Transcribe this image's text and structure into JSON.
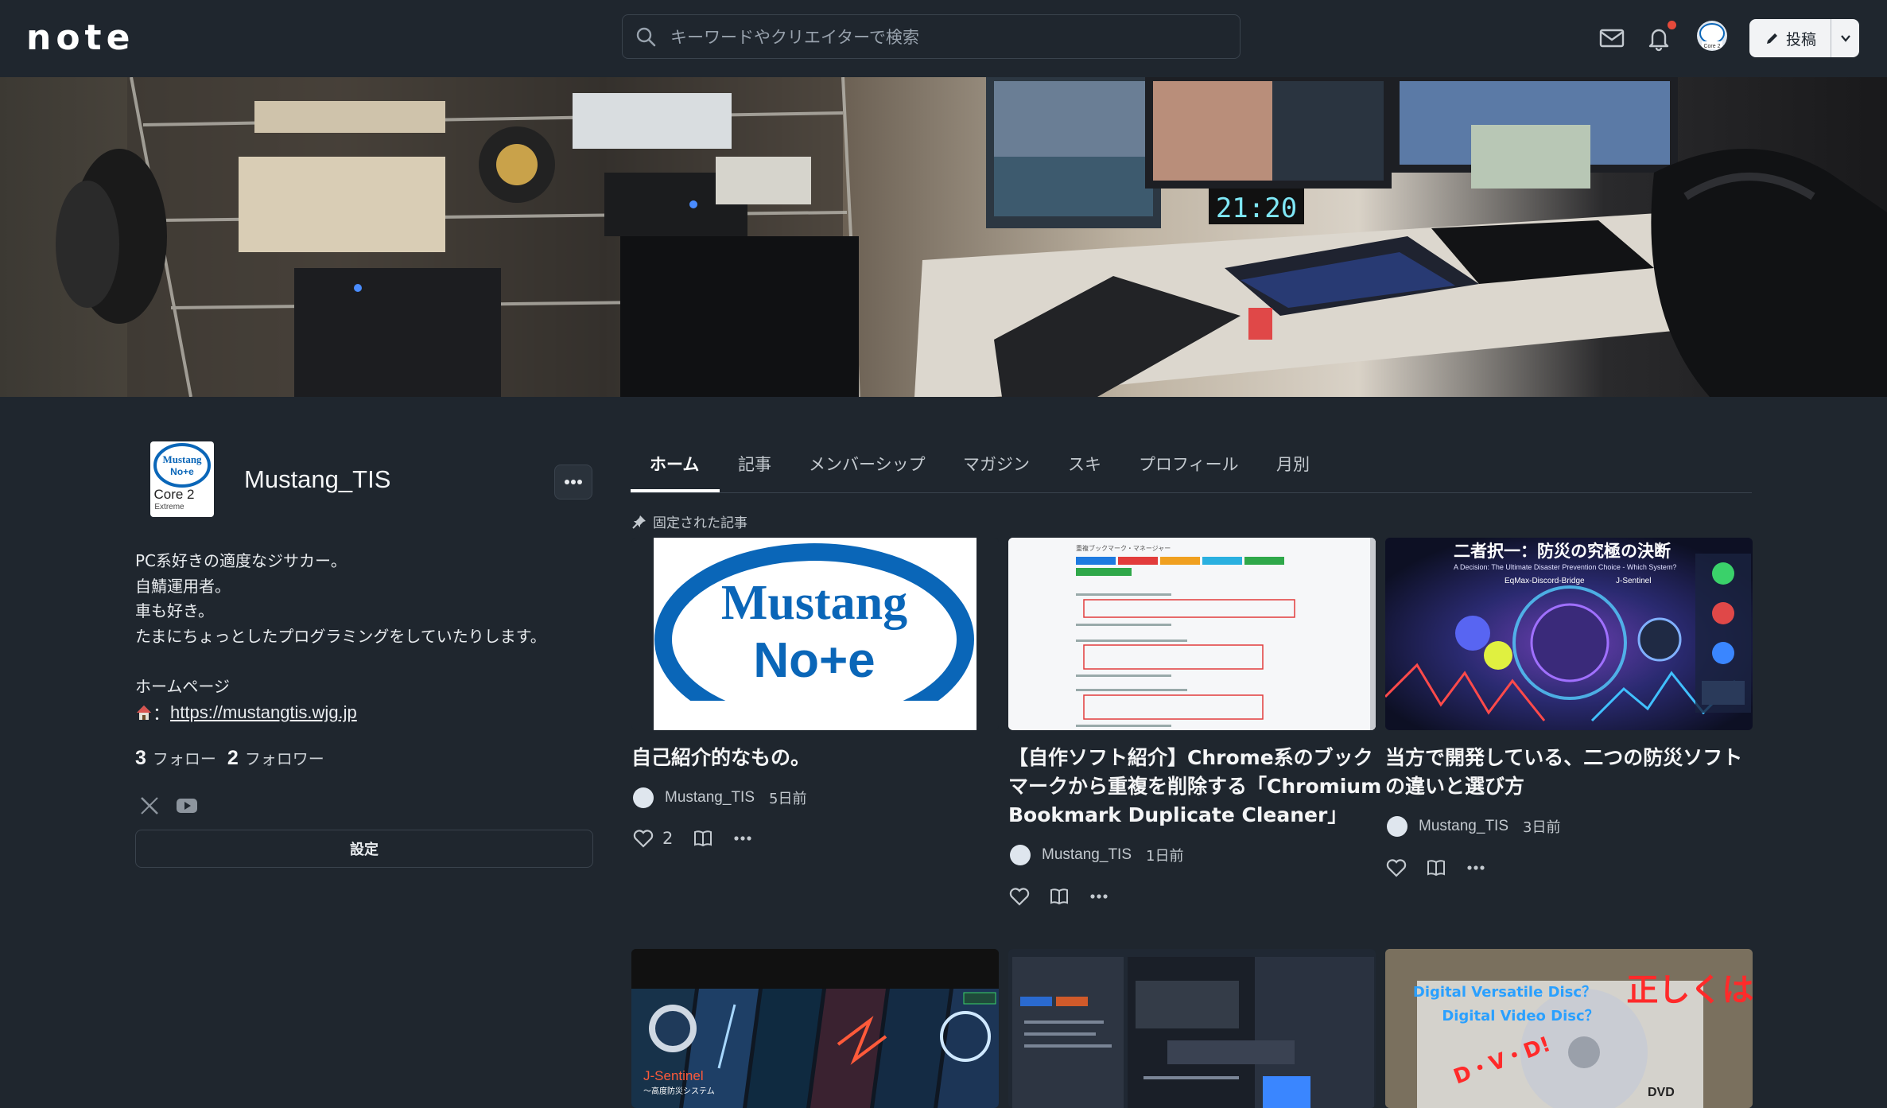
{
  "header": {
    "logo": "note",
    "search_placeholder": "キーワードやクリエイターで検索",
    "post_label": "投稿"
  },
  "profile": {
    "name": "Mustang_TIS",
    "bio": "PC系好きの適度なジサカー。\n自鯖運用者。\n車も好き。\nたまにちょっとしたプログラミングをしていたりします。\n\nホームページ",
    "homepage_prefix": "：",
    "homepage_url": "https://mustangtis.wjg.jp",
    "follow_count": "3",
    "follow_label": "フォロー",
    "follower_count": "2",
    "follower_label": "フォロワー",
    "settings_label": "設定",
    "avatar_text_1": "Mustang",
    "avatar_text_2": "No+e",
    "avatar_text_3": "Core 2",
    "avatar_text_4": "Extreme"
  },
  "tabs": [
    {
      "label": "ホーム",
      "active": true
    },
    {
      "label": "記事"
    },
    {
      "label": "メンバーシップ"
    },
    {
      "label": "マガジン"
    },
    {
      "label": "スキ"
    },
    {
      "label": "プロフィール"
    },
    {
      "label": "月別"
    }
  ],
  "pinned_label": "固定された記事",
  "cards": [
    {
      "title": "自己紹介的なもの。",
      "author": "Mustang_TIS",
      "time": "5日前",
      "likes": "2",
      "thumb_text_1": "Mustang",
      "thumb_text_2": "No+e"
    },
    {
      "title": "【自作ソフト紹介】Chrome系のブックマークから重複を削除する「Chromium Bookmark Duplicate Cleaner」",
      "author": "Mustang_TIS",
      "time": "1日前",
      "likes": "",
      "thumb_text_1": "重複ブックマーク・マネージャー"
    },
    {
      "title": "当方で開発している、二つの防災ソフトの違いと選び方",
      "author": "Mustang_TIS",
      "time": "3日前",
      "likes": "",
      "thumb_text_1": "二者択一：防災の究極の決断",
      "thumb_text_2": "A Decision: The Ultimate Disaster Prevention Choice - Which System?",
      "thumb_text_3": "J-Sentinel",
      "thumb_text_4": "EqMax-Discord-Bridge"
    }
  ],
  "row2": {
    "thumb1_text": "J-Sentinel",
    "thumb1_sub": "〜高度防災システム",
    "thumb3_text_1": "Digital Versatile Disc？",
    "thumb3_text_2": "Digital Video Disc？",
    "thumb3_text_3": "正しくは?",
    "thumb3_text_4": "D・V・D!",
    "thumb3_text_5": "DVD"
  },
  "colors": {
    "bg": "#1f262e",
    "accent_dot": "#e64a3b",
    "intel_blue": "#0a66b8"
  }
}
